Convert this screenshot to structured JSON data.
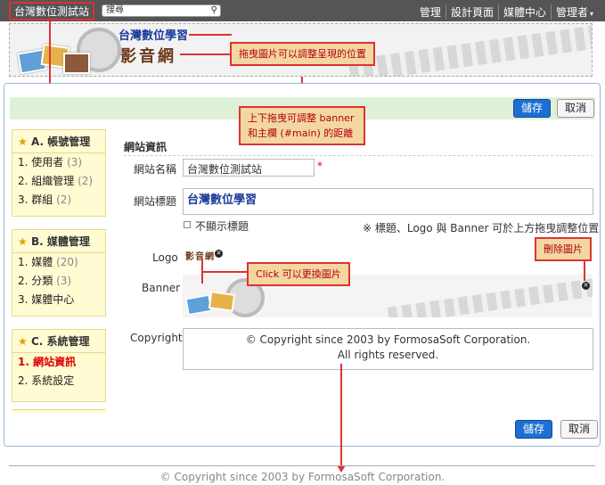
{
  "topbar": {
    "site_title": "台灣數位測試站",
    "search_placeholder": "搜尋",
    "nav": [
      "管理",
      "設計頁面",
      "媒體中心",
      "管理者"
    ]
  },
  "banner": {
    "brand_text": "台灣數位學習",
    "brand_logo_text": "影音網"
  },
  "callouts": {
    "drag_image": "拖曳圖片可以調整呈現的位置",
    "drag_distance_line1": "上下拖曳可調整 banner",
    "drag_distance_line2": "和主欄 (#main) 的距離",
    "click_change": "Click 可以更換圖片",
    "delete_image": "刪除圖片"
  },
  "toolbar": {
    "save_label": "儲存",
    "cancel_label": "取消"
  },
  "sidebar": {
    "groups": [
      {
        "title": "A. 帳號管理",
        "items": [
          {
            "label": "1. 使用者",
            "count": "(3)"
          },
          {
            "label": "2. 組織管理",
            "count": "(2)"
          },
          {
            "label": "3. 群組",
            "count": "(2)"
          }
        ]
      },
      {
        "title": "B. 媒體管理",
        "items": [
          {
            "label": "1. 媒體",
            "count": "(20)"
          },
          {
            "label": "2. 分類",
            "count": "(3)"
          },
          {
            "label": "3. 媒體中心",
            "count": ""
          }
        ]
      },
      {
        "title": "C. 系統管理",
        "items": [
          {
            "label": "1. 網站資訊",
            "count": ""
          },
          {
            "label": "2. 系統設定",
            "count": ""
          }
        ]
      }
    ]
  },
  "form": {
    "section_title": "網站資訊",
    "site_name_label": "網站名稱",
    "site_name_value": "台灣數位測試站",
    "required_mark": "*",
    "site_title_label": "網站標題",
    "site_title_value": "台灣數位學習",
    "hide_title_label": "不顯示標題",
    "position_hint": "※ 標題、Logo 與 Banner 可於上方拖曳調整位置",
    "logo_label": "Logo",
    "logo_text": "影音網",
    "banner_label": "Banner",
    "copyright_label": "Copyright",
    "copyright_line1": "© Copyright since 2003 by FormosaSoft Corporation.",
    "copyright_line2": "All rights reserved."
  },
  "footer": {
    "text": "© Copyright since 2003 by FormosaSoft Corporation."
  },
  "colors": {
    "accent": "#1d6fd1",
    "callout_border": "#dd3333",
    "sidebar_bg": "#fffbd2"
  }
}
